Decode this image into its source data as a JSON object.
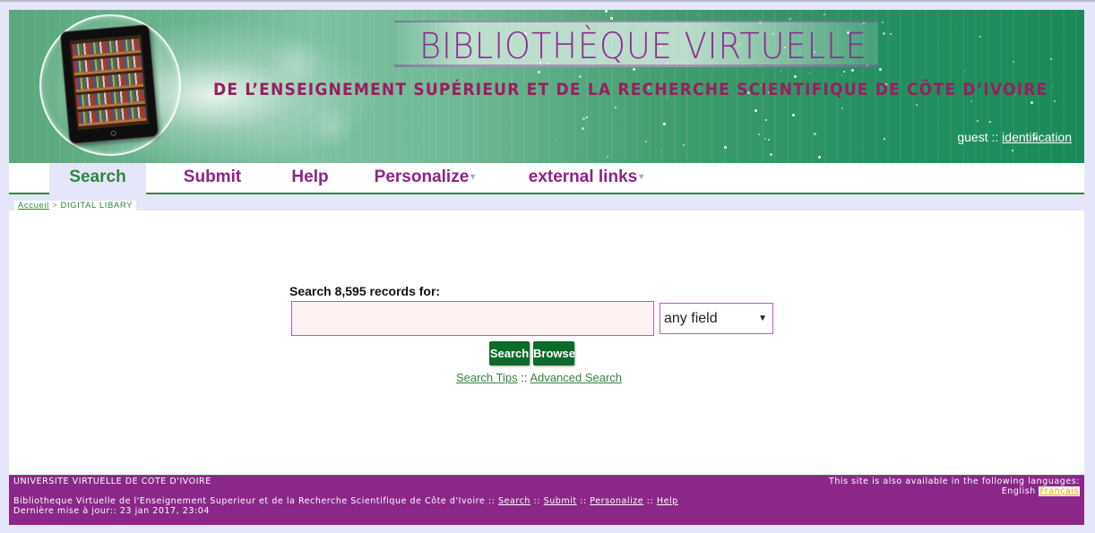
{
  "banner": {
    "title": "BIBLIOTHÈQUE VIRTUELLE",
    "subtitle": "DE L’ENSEIGNEMENT SUPÉRIEUR ET DE LA RECHERCHE SCIENTIFIQUE DE CÔTE D’IVOIRE",
    "logo_icon": "tablet-bookshelf-icon"
  },
  "user": {
    "name": "guest",
    "separator": "::",
    "login_link": "identification"
  },
  "nav": {
    "items": [
      {
        "label": "Search",
        "active": true,
        "dropdown": false
      },
      {
        "label": "Submit",
        "active": false,
        "dropdown": false
      },
      {
        "label": "Help",
        "active": false,
        "dropdown": false
      },
      {
        "label": "Personalize",
        "active": false,
        "dropdown": true
      },
      {
        "label": "external links",
        "active": false,
        "dropdown": true
      }
    ],
    "caret": "▾"
  },
  "breadcrumb": {
    "home": "Accueil",
    "separator": ">",
    "current": "DIGITAL LIBARY"
  },
  "search": {
    "label": "Search 8,595 records for:",
    "record_count": "8,595",
    "input_value": "",
    "input_placeholder": "",
    "field_select": "any field",
    "select_arrow": "▼",
    "search_button": "Search",
    "browse_button": "Browse",
    "tips_link": "Search Tips",
    "links_separator": "::",
    "advanced_link": "Advanced Search"
  },
  "footer": {
    "org": "UNIVERSITE VIRTUELLE DE COTE D'IVOIRE",
    "site_name": "Bibliotheque Virtuelle de l'Enseignement Superieur et de la Recherche Scientifique de Côte d'Ivoire",
    "sep": "::",
    "links": [
      "Search",
      "Submit",
      "Personalize",
      "Help"
    ],
    "last_update_label": "Dernière mise à jour::",
    "last_update": "23 jan 2017, 23:04",
    "languages_label": "This site is also available in the following languages:",
    "languages": [
      "English",
      "Français"
    ],
    "active_language": "Français"
  },
  "colors": {
    "accent_green": "#2e8540",
    "button_green": "#0a6b2a",
    "nav_purple": "#8b2489",
    "footer_purple": "#8b2789",
    "page_bg": "#e6e6fa",
    "input_bg": "#fff2f2",
    "input_border": "#c055c5"
  }
}
